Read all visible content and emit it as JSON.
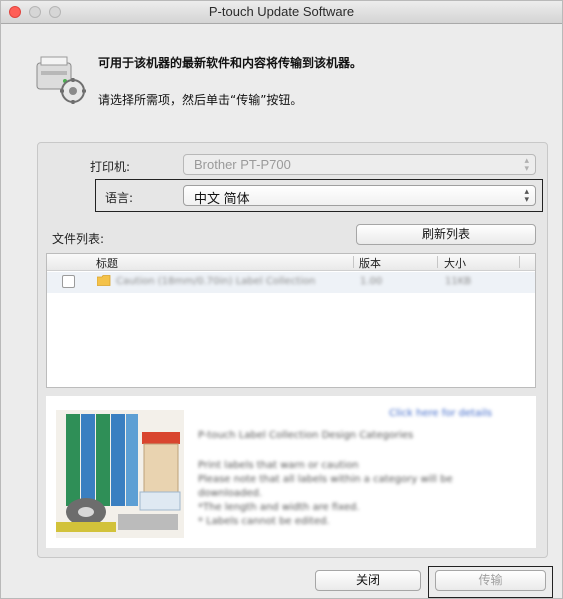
{
  "window": {
    "title": "P-touch Update Software"
  },
  "header": {
    "icon": "printer-transfer-icon",
    "line1": "可用于该机器的最新软件和内容将传输到该机器。",
    "line2": "请选择所需项，然后单击“传输”按钮。"
  },
  "printer": {
    "label": "打印机:",
    "value": "Brother PT-P700"
  },
  "language": {
    "label": "语言:",
    "value": "中文 简体"
  },
  "file_list": {
    "label": "文件列表:",
    "refresh_button": "刷新列表",
    "columns": [
      "标题",
      "版本",
      "大小"
    ],
    "rows": [
      {
        "checked": false,
        "icon": "folder-icon",
        "title": "Caution (18mm/0.70in) Label Collection",
        "version": "1.00",
        "size": "11KB"
      }
    ]
  },
  "description": {
    "link": "Click here for details",
    "heading": "P-touch Label Collection Design Categories",
    "lines": [
      "Print labels that warn or caution",
      "Please note that all labels within a category will be",
      "downloaded.",
      "*The length and width are fixed.",
      "* Labels cannot be edited."
    ]
  },
  "footer": {
    "close_button": "关闭",
    "transfer_button": "传输"
  },
  "colors": {
    "close_dot": "#ff5f57",
    "window_bg": "#ececec",
    "link": "#3f69c9",
    "folder": "#f4c24a"
  }
}
